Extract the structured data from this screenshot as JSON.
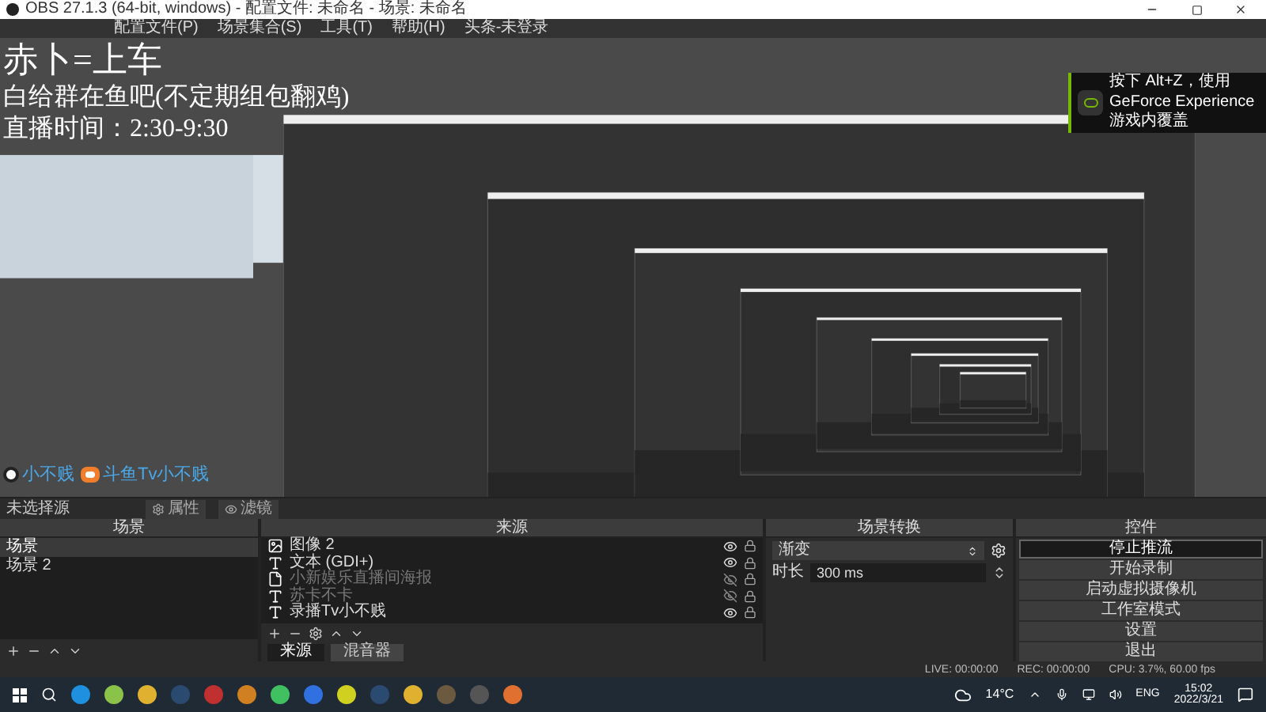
{
  "window": {
    "title": "OBS 27.1.3 (64-bit, windows) - 配置文件: 未命名 - 场景: 未命名"
  },
  "menu": [
    "配置文件(P)",
    "场景集合(S)",
    "工具(T)",
    "帮助(H)",
    "头条-未登录"
  ],
  "preview": {
    "overlay_lines": [
      "赤卜=上车",
      "白给群在鱼吧(不定期组包翻鸡)",
      "直播时间：2:30-9:30"
    ],
    "channel_tags": [
      {
        "kind": "circle",
        "label": "小不贱"
      },
      {
        "kind": "eye",
        "label": "斗鱼Tv小不贱"
      }
    ],
    "notification": "按下 Alt+Z，使用 GeForce Experience 游戏内覆盖"
  },
  "source_bar": {
    "label": "未选择源",
    "buttons": [
      "属性",
      "滤镜"
    ]
  },
  "scenes": {
    "title": "场景",
    "items": [
      {
        "label": "场景",
        "selected": true
      },
      {
        "label": "场景 2",
        "selected": false
      }
    ]
  },
  "sources": {
    "title": "来源",
    "items": [
      {
        "kind": "image",
        "label": "图像 2",
        "visible": true
      },
      {
        "kind": "text",
        "label": "文本 (GDI+)",
        "visible": true
      },
      {
        "kind": "file",
        "label": "小新娱乐直播间海报",
        "visible": false
      },
      {
        "kind": "text",
        "label": "苏卡不卡",
        "visible": false
      },
      {
        "kind": "text",
        "label": "录播Tv小不贱",
        "visible": true
      }
    ]
  },
  "dock_tabs": [
    {
      "label": "来源",
      "selected": true
    },
    {
      "label": "混音器",
      "selected": false
    }
  ],
  "transitions": {
    "title": "场景转换",
    "type": "渐变",
    "duration_label": "时长",
    "duration": "300 ms"
  },
  "controls": {
    "title": "控件",
    "buttons": [
      {
        "label": "停止推流",
        "active": true
      },
      {
        "label": "开始录制",
        "active": false
      },
      {
        "label": "启动虚拟摄像机",
        "active": false
      },
      {
        "label": "工作室模式",
        "active": false
      },
      {
        "label": "设置",
        "active": false
      },
      {
        "label": "退出",
        "active": false
      }
    ]
  },
  "status_bar": {
    "live": "LIVE: 00:00:00",
    "rec": "REC: 00:00:00",
    "cpu": "CPU: 3.7%, 60.00 fps"
  },
  "taskbar": {
    "weather": "14°C",
    "language": "ENG",
    "time": "15:02",
    "date": "2022/3/21"
  }
}
